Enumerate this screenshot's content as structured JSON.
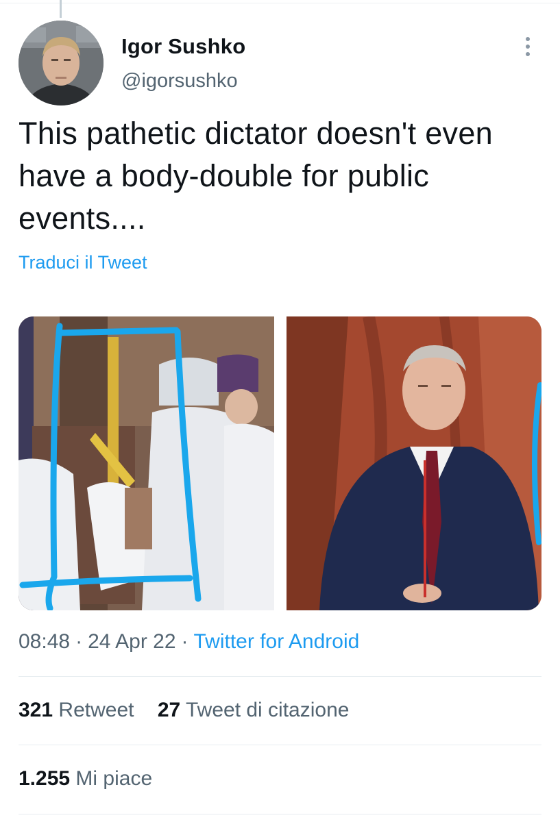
{
  "tweet": {
    "display_name": "Igor Sushko",
    "handle": "@igorsushko",
    "text": "This pathetic dictator doesn't even have a body-double for public events....",
    "translate_label": "Traduci il Tweet",
    "time": "08:48",
    "date": "24 Apr 22",
    "source": "Twitter for Android",
    "separator": "·"
  },
  "stats": {
    "retweets_count": "321",
    "retweets_label": "Retweet",
    "quotes_count": "27",
    "quotes_label": "Tweet di citazione",
    "likes_count": "1.255",
    "likes_label": "Mi piace"
  },
  "icons": {
    "more": "more-vertical-icon",
    "avatar": "profile-photo"
  },
  "colors": {
    "link": "#1d9bf0",
    "secondary_text": "#536471",
    "primary_text": "#0f1419",
    "annotation_blue": "#1aa7ec"
  }
}
